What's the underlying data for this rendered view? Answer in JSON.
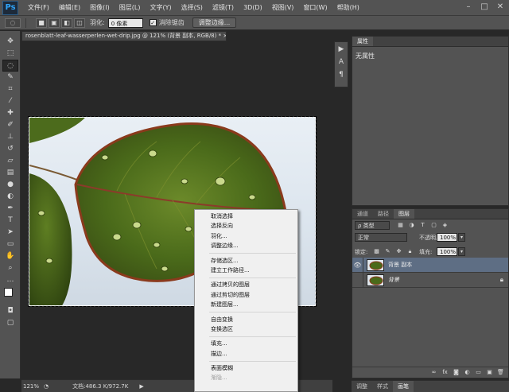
{
  "app": {
    "logo": "Ps",
    "menu": [
      "文件(F)",
      "编辑(E)",
      "图像(I)",
      "图层(L)",
      "文字(Y)",
      "选择(S)",
      "滤镜(T)",
      "3D(D)",
      "视图(V)",
      "窗口(W)",
      "帮助(H)"
    ],
    "window_controls": [
      "–",
      "□",
      "✕"
    ]
  },
  "options": {
    "feather_label": "羽化:",
    "feather_value": "0 像素",
    "antialias_label": "消除锯齿",
    "antialias_checked": "✓",
    "refine_button": "调整边缘..."
  },
  "document": {
    "tab_title": "rosenblatt-leaf-wasserperlen-wet-drip.jpg @ 121% (背景 副本, RGB/8) * ×"
  },
  "status": {
    "zoom": "121%",
    "doc_info": "文档:486.3 K/972.7K",
    "arrow": "▶"
  },
  "properties": {
    "tab": "属性",
    "content": "无属性"
  },
  "layers": {
    "tabs": [
      "通道",
      "路径",
      "图层"
    ],
    "filter_kind": "ρ 类型",
    "blend_mode": "正常",
    "opacity_label": "不透明度:",
    "opacity_value": "100%",
    "lock_label": "锁定:",
    "fill_label": "填充:",
    "fill_value": "100%",
    "items": [
      {
        "name": "背景 副本",
        "selected": true,
        "visible": true
      },
      {
        "name": "背景",
        "selected": false,
        "visible": false,
        "locked": true
      }
    ]
  },
  "bottom_tabs": [
    "调整",
    "样式",
    "画笔"
  ],
  "context_menu": {
    "groups": [
      [
        "取消选择",
        "选择反向",
        "羽化...",
        "调整边缘..."
      ],
      [
        "存储选区...",
        "建立工作路径..."
      ],
      [
        "通过拷贝的图层",
        "通过剪切的图层",
        "新建图层..."
      ],
      [
        "自由变换",
        "变换选区"
      ],
      [
        "填充...",
        "描边..."
      ],
      [
        "表面模糊"
      ]
    ],
    "disabled_item": "渐隐..."
  },
  "colors": {
    "panel": "#535353",
    "canvas": "#282828",
    "selection_highlight": "#5e6e84",
    "leaf_dark": "#3e5416",
    "leaf_edge": "#8a3a1c"
  }
}
